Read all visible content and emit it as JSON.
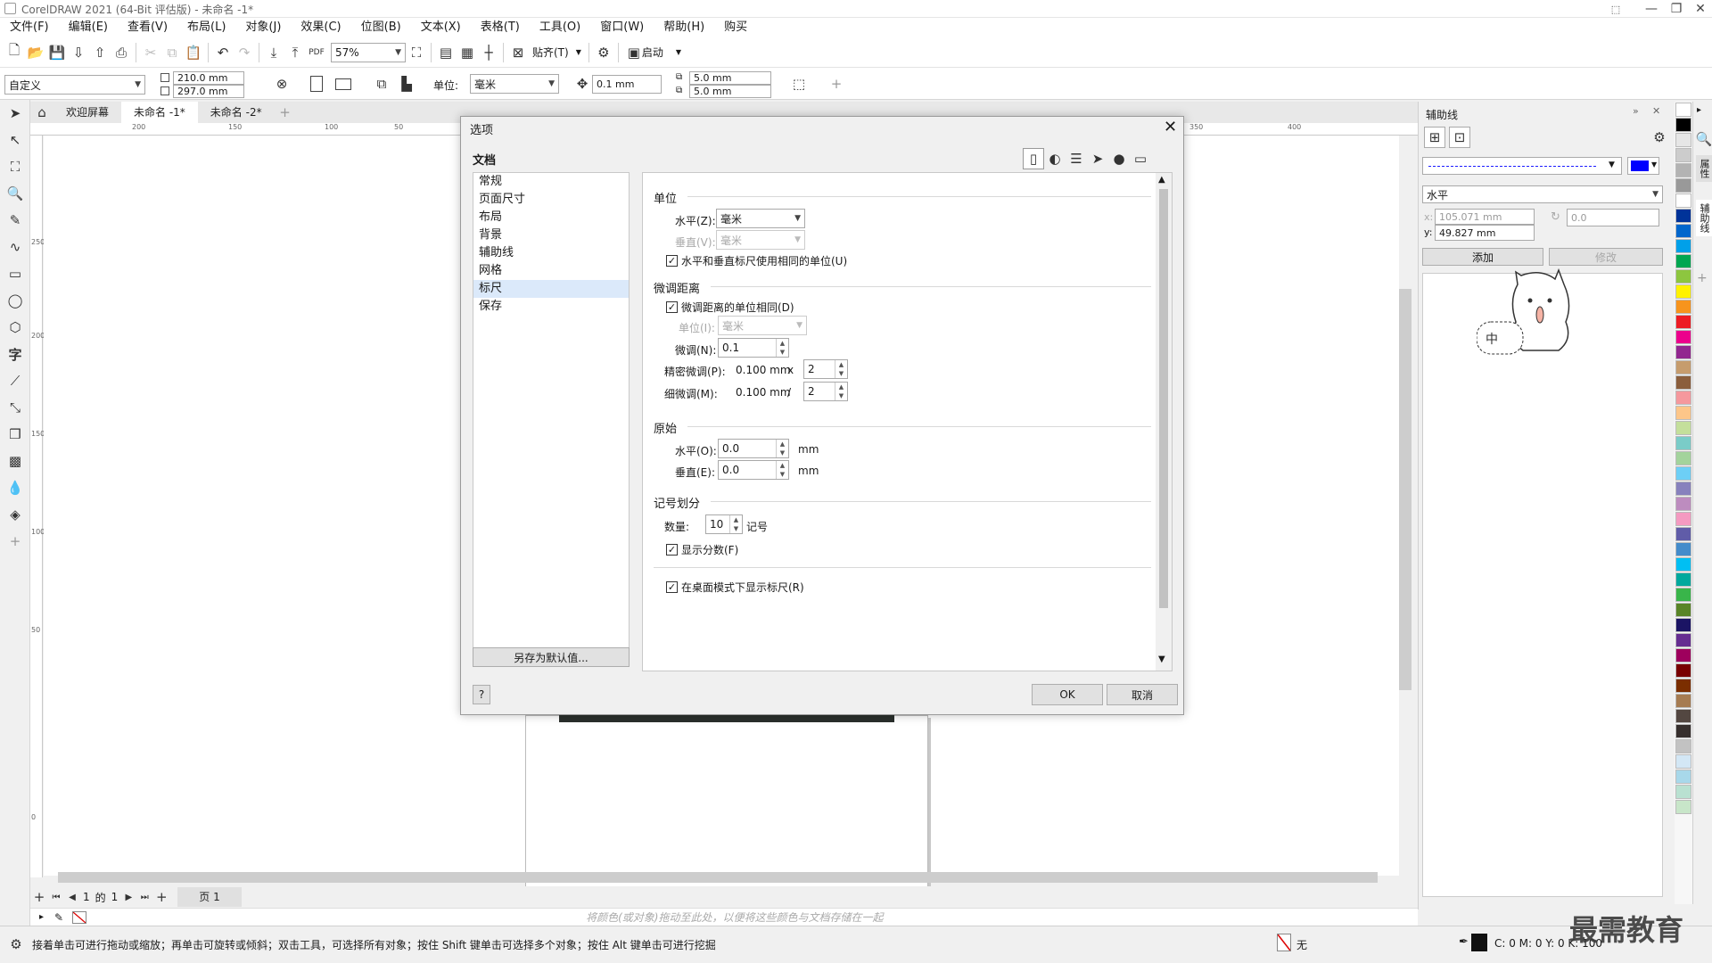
{
  "app": {
    "title": "CorelDRAW 2021 (64-Bit 评估版) - 未命名 -1*"
  },
  "menu": [
    "文件(F)",
    "编辑(E)",
    "查看(V)",
    "布局(L)",
    "对象(J)",
    "效果(C)",
    "位图(B)",
    "文本(X)",
    "表格(T)",
    "工具(O)",
    "窗口(W)",
    "帮助(H)",
    "购买"
  ],
  "toolbar": {
    "zoom": "57%",
    "snap_label": "贴齐(T)",
    "launch_label": "启动"
  },
  "propbar": {
    "preset": "自定义",
    "width": "210.0 mm",
    "height": "297.0 mm",
    "units_label": "单位:",
    "units_value": "毫米",
    "nudge": "0.1 mm",
    "dup_x": "5.0 mm",
    "dup_y": "5.0 mm"
  },
  "tabs": {
    "home": "欢迎屏幕",
    "doc1": "未命名 -1*",
    "doc2": "未命名 -2*"
  },
  "ruler": {
    "h": [
      "200",
      "150",
      "100",
      "50",
      "350",
      "400"
    ],
    "v": [
      "250",
      "200",
      "150",
      "100",
      "50",
      "0"
    ]
  },
  "dialog": {
    "title": "选项",
    "section": "文档",
    "nav": [
      "常规",
      "页面尺寸",
      "布局",
      "背景",
      "辅助线",
      "网格",
      "标尺",
      "保存"
    ],
    "save_default": "另存为默认值...",
    "help": "?",
    "ok": "OK",
    "cancel": "取消",
    "units": {
      "title": "单位",
      "h_label": "水平(Z):",
      "h_value": "毫米",
      "v_label": "垂直(V):",
      "v_value": "毫米",
      "same_label": "水平和垂直标尺使用相同的单位(U)"
    },
    "nudge": {
      "title": "微调距离",
      "same_label": "微调距离的单位相同(D)",
      "unit_label": "单位(I):",
      "unit_value": "毫米",
      "nudge_label": "微调(N):",
      "nudge_value": "0.1",
      "super_label": "精密微调(P):",
      "super_value": "0.100 mm",
      "super_op": "x",
      "super_mult": "2",
      "micro_label": "细微调(M):",
      "micro_value": "0.100 mm",
      "micro_op": "/",
      "micro_div": "2"
    },
    "origin": {
      "title": "原始",
      "h_label": "水平(O):",
      "h_value": "0.0",
      "v_label": "垂直(E):",
      "v_value": "0.0",
      "unit": "mm"
    },
    "ticks": {
      "title": "记号划分",
      "count_label": "数量:",
      "count_value": "10",
      "count_unit": "记号",
      "fractions_label": "显示分数(F)",
      "desktop_label": "在桌面模式下显示标尺(R)"
    }
  },
  "docker": {
    "title": "辅助线",
    "orientation": "水平",
    "x": "105.071 mm",
    "y_label": "y:",
    "y": "49.827 mm",
    "angle": "0.0",
    "add": "添加",
    "modify": "修改",
    "sticker_text": "中",
    "line_color": "#0000ff",
    "side_tabs": [
      "属性",
      "辅助线"
    ]
  },
  "pagebar": {
    "current": "1",
    "of": "的",
    "total": "1",
    "page_tab": "页 1"
  },
  "colorbar": {
    "hint": "将颜色(或对象)拖动至此处，以便将这些颜色与文档存储在一起"
  },
  "status": {
    "text": "接着单击可进行拖动或缩放；再单击可旋转或倾斜；双击工具，可选择所有对象；按住 Shift 键单击可选择多个对象；按住 Alt 键单击可进行挖掘",
    "fill": "无",
    "cmyk": "C: 0 M: 0 Y: 0 K: 100"
  },
  "palette": [
    "#ffffff",
    "#000000",
    "#e6e6e6",
    "#cccccc",
    "#b3b3b3",
    "#999999",
    "#ffffff",
    "#003399",
    "#0066cc",
    "#00a0e9",
    "#00a651",
    "#8dc63f",
    "#fff200",
    "#f7941d",
    "#ed1c24",
    "#ec008c",
    "#92278f",
    "#c69c6d",
    "#8b5e3c",
    "#f5989d",
    "#fdc689",
    "#c4df9b",
    "#7accc8",
    "#a3d39c",
    "#6dcff6",
    "#8781bd",
    "#bd8cbf",
    "#f49ac1",
    "#605ca8",
    "#448ccb",
    "#00bff3",
    "#00a99d",
    "#39b54a",
    "#598527",
    "#1b1464",
    "#662d91",
    "#9e005d",
    "#790000",
    "#7b2e00",
    "#a67c52",
    "#534741",
    "#362f2d",
    "#c2c2c2",
    "#d3e7f5",
    "#a8d8ea",
    "#b9e1d1",
    "#c8e6c9"
  ],
  "watermark": "最需教育"
}
